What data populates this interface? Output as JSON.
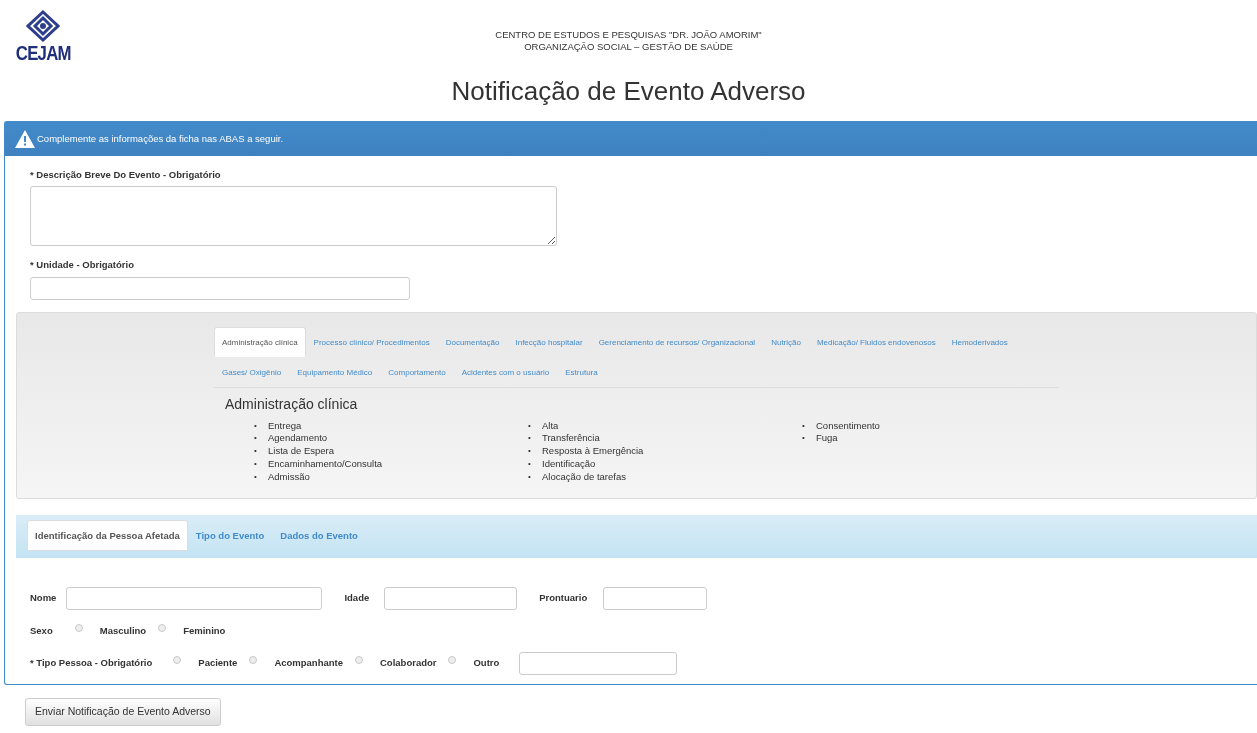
{
  "header": {
    "logo_text": "CEJAM",
    "org_lines": [
      "CENTRO DE ESTUDOS E PESQUISAS \"DR. JOÃO AMORIM\"",
      "ORGANIZAÇÃO SOCIAL – GESTÃO DE SAÚDE"
    ],
    "title": "Notificação de Evento Adverso"
  },
  "alert": {
    "message": "Complemente as informações da ficha nas ABAS a seguir."
  },
  "fields": [
    {
      "label": "* Descrição Breve Do Evento - Obrigatório",
      "kind": "textarea"
    },
    {
      "label": "* Unidade - Obrigatório",
      "kind": "input"
    }
  ],
  "categories": {
    "tabs": [
      {
        "label": "Administração clínica",
        "selected": true
      },
      {
        "label": "Processo clínico/ Procedimentos",
        "selected": false
      },
      {
        "label": "Documentação",
        "selected": false
      },
      {
        "label": "Infecção hospitalar",
        "selected": false
      },
      {
        "label": "Gerenciamento de recursos/ Organizacional",
        "selected": false
      },
      {
        "label": "Nutrição",
        "selected": false
      },
      {
        "label": "Medicação/ Fluidos endovenosos",
        "selected": false
      },
      {
        "label": "Hemoderivados",
        "selected": false
      },
      {
        "label": "Gases/ Oxigênio",
        "selected": false
      },
      {
        "label": "Equipamento Médico",
        "selected": false
      },
      {
        "label": "Comportamento",
        "selected": false
      },
      {
        "label": "Acidentes com o usuário",
        "selected": false
      },
      {
        "label": "Estrutura",
        "selected": false
      }
    ],
    "panel_title": "Administração clínica",
    "bullet": "•",
    "columns": [
      [
        "Entrega",
        "Agendamento",
        "Lista de Espera",
        "Encaminhamento/Consulta",
        "Admissão"
      ],
      [
        "Alta",
        "Transferência",
        "Resposta à Emergência",
        "Identificação",
        "Alocação de tarefas"
      ],
      [
        "Consentimento",
        "Fuga"
      ]
    ]
  },
  "section_tabs": [
    {
      "label": "Identificação da Pessoa Afetada",
      "selected": true
    },
    {
      "label": "Tipo do Evento",
      "selected": false
    },
    {
      "label": "Dados do Evento",
      "selected": false
    }
  ],
  "person": {
    "text_fields": [
      {
        "label": "Nome"
      },
      {
        "label": "Idade"
      },
      {
        "label": "Prontuario"
      }
    ],
    "sexo": {
      "label": "Sexo",
      "options": [
        {
          "label": "Masculino",
          "selected": false
        },
        {
          "label": "Feminino",
          "selected": false
        }
      ]
    },
    "tipo": {
      "label": "* Tipo Pessoa - Obrigatório",
      "options": [
        {
          "label": "Paciente",
          "selected": false
        },
        {
          "label": "Acompanhante",
          "selected": false
        },
        {
          "label": "Colaborador",
          "selected": false
        },
        {
          "label": "Outro",
          "selected": false
        }
      ]
    }
  },
  "submit": {
    "label": "Enviar Notificação de Evento Adverso"
  }
}
